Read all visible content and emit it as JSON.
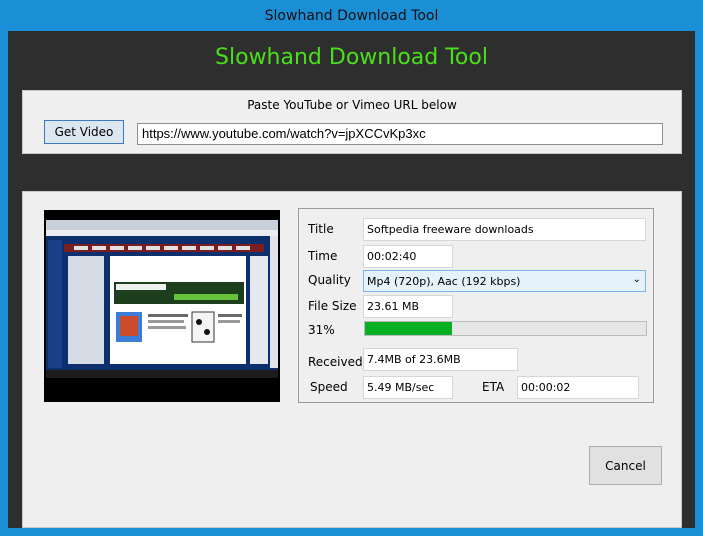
{
  "window": {
    "title": "Slowhand Download Tool"
  },
  "app": {
    "title": "Slowhand Download Tool"
  },
  "url_section": {
    "hint": "Paste YouTube or Vimeo URL below",
    "get_video_label": "Get Video",
    "url_value": "https://www.youtube.com/watch?v=jpXCCvKp3xc"
  },
  "video_info": {
    "title_label": "Title",
    "title_value": "Softpedia freeware downloads",
    "time_label": "Time",
    "time_value": "00:02:40",
    "quality_label": "Quality",
    "quality_value": "Mp4 (720p), Aac (192 kbps)",
    "filesize_label": "File Size",
    "filesize_value": "23.61 MB",
    "progress_label": "31%",
    "progress_fraction": 0.31,
    "received_label": "Received",
    "received_value": "7.4MB of 23.6MB",
    "speed_label": "Speed",
    "speed_value": "5.49 MB/sec",
    "eta_label": "ETA",
    "eta_value": "00:00:02"
  },
  "cancel_label": "Cancel",
  "colors": {
    "title_green": "#49e01b",
    "progress_green": "#06b025",
    "frame_blue": "#1b8fd6",
    "window_dark": "#2e2e2e"
  }
}
